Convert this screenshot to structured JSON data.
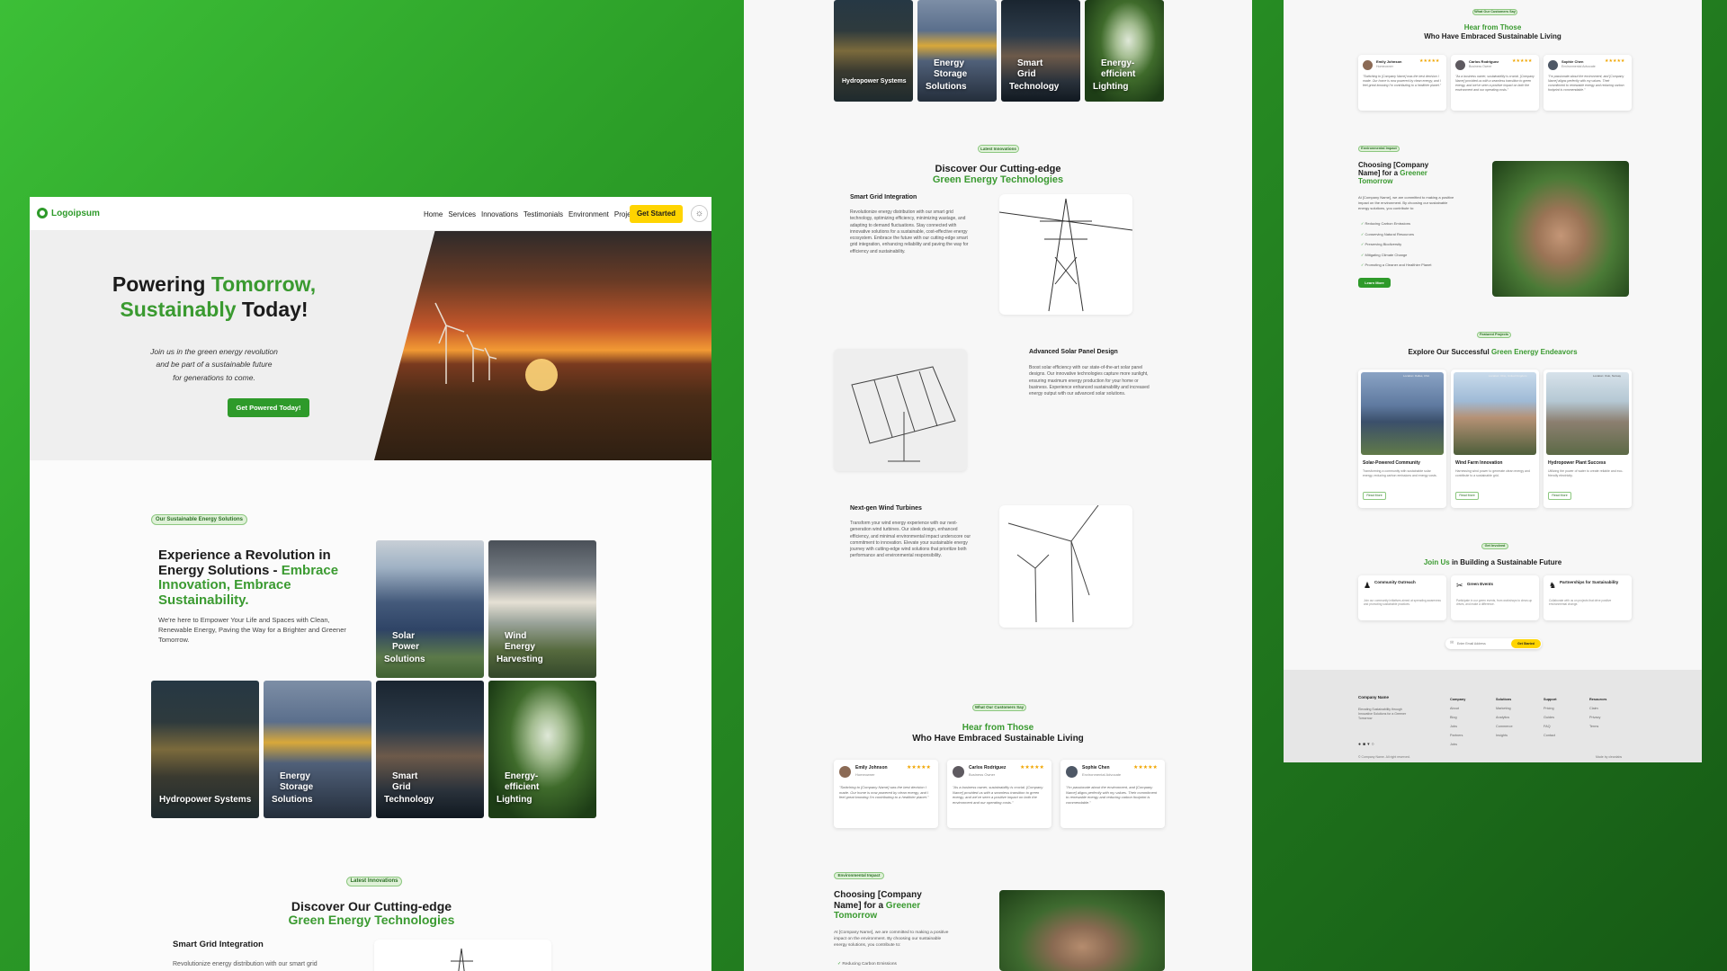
{
  "colors": {
    "accent": "#3a9a30",
    "cta": "#ffd400",
    "background": "#2b9c27"
  },
  "p1": {
    "logo": "Logoipsum",
    "nav": [
      "Home",
      "Services",
      "Innovations",
      "Testimonials",
      "Environment",
      "Projects"
    ],
    "cta": "Get Started",
    "hero": {
      "l1a": "Powering ",
      "l1b": "Tomorrow,",
      "l2a": "Sustainably",
      " l2b": "",
      "l2c": " Today!",
      "sub1": "Join us in the green energy revolution",
      "sub2": "and be part of a sustainable future",
      "sub3": "for generations to come.",
      "btn": "Get Powered Today!"
    },
    "solutions": {
      "badge": "Our Sustainable Energy Solutions",
      "h1": "Experience a Revolution in",
      "h2": "Energy Solutions - ",
      "h3": "Embrace",
      "h4": "Innovation, Embrace",
      "h5": "Sustainability.",
      "desc": "We're here to Empower Your Life and Spaces with Clean, Renewable Energy, Paving the Way for a Brighter and Greener Tomorrow.",
      "tiles": [
        {
          "a": "Solar Power",
          "b": "Solutions"
        },
        {
          "a": "Wind Energy",
          "b": "Harvesting"
        },
        {
          "a": "Hydropower Systems",
          "b": ""
        },
        {
          "a": "Energy Storage",
          "b": "Solutions"
        },
        {
          "a": "Smart Grid",
          "b": "Technology"
        },
        {
          "a": "Energy-efficient",
          "b": "Lighting"
        }
      ]
    },
    "innov": {
      "badge": "Latest Innovations",
      "t1": "Discover Our Cutting-edge",
      "t2": "Green Energy Technologies",
      "item": "Smart Grid Integration",
      "text": "Revolutionize energy distribution with our smart grid"
    }
  },
  "p2": {
    "tiles": [
      {
        "a": "Hydropower Systems",
        "b": ""
      },
      {
        "a": "Energy Storage",
        "b": "Solutions"
      },
      {
        "a": "Smart Grid",
        "b": "Technology"
      },
      {
        "a": "Energy-efficient",
        "b": "Lighting"
      }
    ],
    "badge": "Latest Innovations",
    "t1": "Discover Our Cutting-edge",
    "t2": "Green Energy Technologies",
    "items": [
      {
        "title": "Smart Grid Integration",
        "text": "Revolutionize energy distribution with our smart grid technology, optimizing efficiency, minimizing wastage, and adapting to demand fluctuations. Stay connected with innovative solutions for a sustainable, cost-effective energy ecosystem. Embrace the future with our cutting-edge smart grid integration, enhancing reliability and paving the way for efficiency and sustainability."
      },
      {
        "title": "Advanced Solar Panel Design",
        "text": "Boost solar efficiency with our state-of-the-art solar panel designs. Our innovative technologies capture more sunlight, ensuring maximum energy production for your home or business. Experience enhanced sustainability and increased energy output with our advanced solar solutions."
      },
      {
        "title": "Next-gen Wind Turbines",
        "text": "Transform your wind energy experience with our next-generation wind turbines. Our sleek design, enhanced efficiency, and minimal environmental impact underscore our commitment to innovation. Elevate your sustainable energy journey with cutting-edge wind solutions that prioritize both performance and environmental responsibility."
      }
    ],
    "testi": {
      "badge": "What Our Customers Say",
      "t1": "Hear from Those",
      "t2": "Who Have Embraced Sustainable Living",
      "cards": [
        {
          "name": "Emily Johnson",
          "role": "Homeowner",
          "stars": "★★★★★",
          "quote": "\"Switching to [Company Name] was the best decision I made. Our home is now powered by clean energy, and I feel great knowing I'm contributing to a healthier planet.\""
        },
        {
          "name": "Carlos Rodriguez",
          "role": "Business Owner",
          "stars": "★★★★★",
          "quote": "\"As a business owner, sustainability is crucial. [Company Name] provided us with a seamless transition to green energy, and we've seen a positive impact on both the environment and our operating costs.\""
        },
        {
          "name": "Sophie Chen",
          "role": "Environmental Advocate",
          "stars": "★★★★★",
          "quote": "\"I'm passionate about the environment, and [Company Name] aligns perfectly with my values. Their commitment to renewable energy and reducing carbon footprint is commendable.\""
        }
      ]
    },
    "env": {
      "badge": "Environmental Impact",
      "h1": "Choosing [Company",
      "h2": "Name] for a ",
      "h3": "Greener",
      "h4": "Tomorrow",
      "text": "At [Company Name], we are committed to making a positive impact on the environment. By choosing our sustainable energy solutions, you contribute to:",
      "first": "Reducing Carbon Emissions"
    }
  },
  "p3": {
    "badge": "What Our Customers Say",
    "t1": "Hear from Those",
    "t2": "Who Have Embraced Sustainable Living",
    "cards": [
      {
        "name": "Emily Johnson",
        "role": "Homeowner",
        "stars": "★★★★★",
        "quote": "\"Switching to [Company Name] was the best decision I made. Our home is now powered by clean energy, and I feel great knowing I'm contributing to a healthier planet.\""
      },
      {
        "name": "Carlos Rodriguez",
        "role": "Business Owner",
        "stars": "★★★★★",
        "quote": "\"As a business owner, sustainability is crucial. [Company Name] provided us with a seamless transition to green energy, and we've seen a positive impact on both the environment and our operating costs.\""
      },
      {
        "name": "Sophie Chen",
        "role": "Environmental Advocate",
        "stars": "★★★★★",
        "quote": "\"I'm passionate about the environment, and [Company Name] aligns perfectly with my values. Their commitment to renewable energy and reducing carbon footprint is commendable.\""
      }
    ],
    "env": {
      "badge": "Environmental Impact",
      "h1": "Choosing [Company",
      "h2": "Name] for a ",
      "h3": "Greener",
      "h4": "Tomorrow",
      "text": "At [Company Name], we are committed to making a positive impact on the environment. By choosing our sustainable energy solutions, you contribute to:",
      "list": [
        "Reducing Carbon Emissions",
        "Conserving Natural Resources",
        "Preserving Biodiversity",
        "Mitigating Climate Change",
        "Promoting a Cleaner and Healthier Planet"
      ],
      "btn": "Learn More"
    },
    "proj": {
      "badge": "Featured Projects",
      "t1": "Explore Our Successful ",
      "t2": "Green Energy Endeavors",
      "cards": [
        {
          "tag": "Location: Dallas, USA",
          "title": "Solar-Powered Community",
          "text": "Transforming a community with sustainable solar energy, reducing carbon emissions and energy costs.",
          "btn": "Read More"
        },
        {
          "tag": "Location: Ohio, United Kingdom",
          "title": "Wind Farm Innovation",
          "text": "Harnessing wind power to generate clean energy and contribute to a sustainable grid.",
          "btn": "Read More"
        },
        {
          "tag": "Location: Oslo, Norway",
          "title": "Hydropower Plant Success",
          "text": "Utilizing the power of water to create reliable and eco-friendly electricity.",
          "btn": "Read More"
        }
      ]
    },
    "join": {
      "badge": "Get Involved",
      "t1": "Join Us",
      "t2": " in Building a Sustainable Future",
      "cards": [
        {
          "title": "Community Outreach",
          "text": "Join our community initiatives aimed at spreading awareness and promoting sustainable practices."
        },
        {
          "title": "Green Events",
          "text": "Participate in our green events, from workshops to clean-up drives, and make a difference."
        },
        {
          "title": "Partnerships for Sustainability",
          "text": "Collaborate with us on projects that drive positive environmental change."
        }
      ],
      "placeholder": "Enter Email Address",
      "btn": "Get Started"
    },
    "footer": {
      "name": "Company Name",
      "desc": "Elevating Sustainability through Innovative Solutions for a Greener Tomorrow",
      "cols": [
        {
          "h": "Company",
          "items": [
            "About",
            "Blog",
            "Jobs",
            "Partners",
            "Jobs"
          ]
        },
        {
          "h": "Solutions",
          "items": [
            "Marketing",
            "Analytics",
            "Commerce",
            "Insights"
          ]
        },
        {
          "h": "Support",
          "items": [
            "Pricing",
            "Guides",
            "FAQ",
            "Contact"
          ]
        },
        {
          "h": "Resources",
          "items": [
            "Claim",
            "Privacy",
            "Terms"
          ]
        }
      ],
      "copy": "© Company Name. All right reserved.",
      "made": "Made by cleanlabs"
    }
  }
}
